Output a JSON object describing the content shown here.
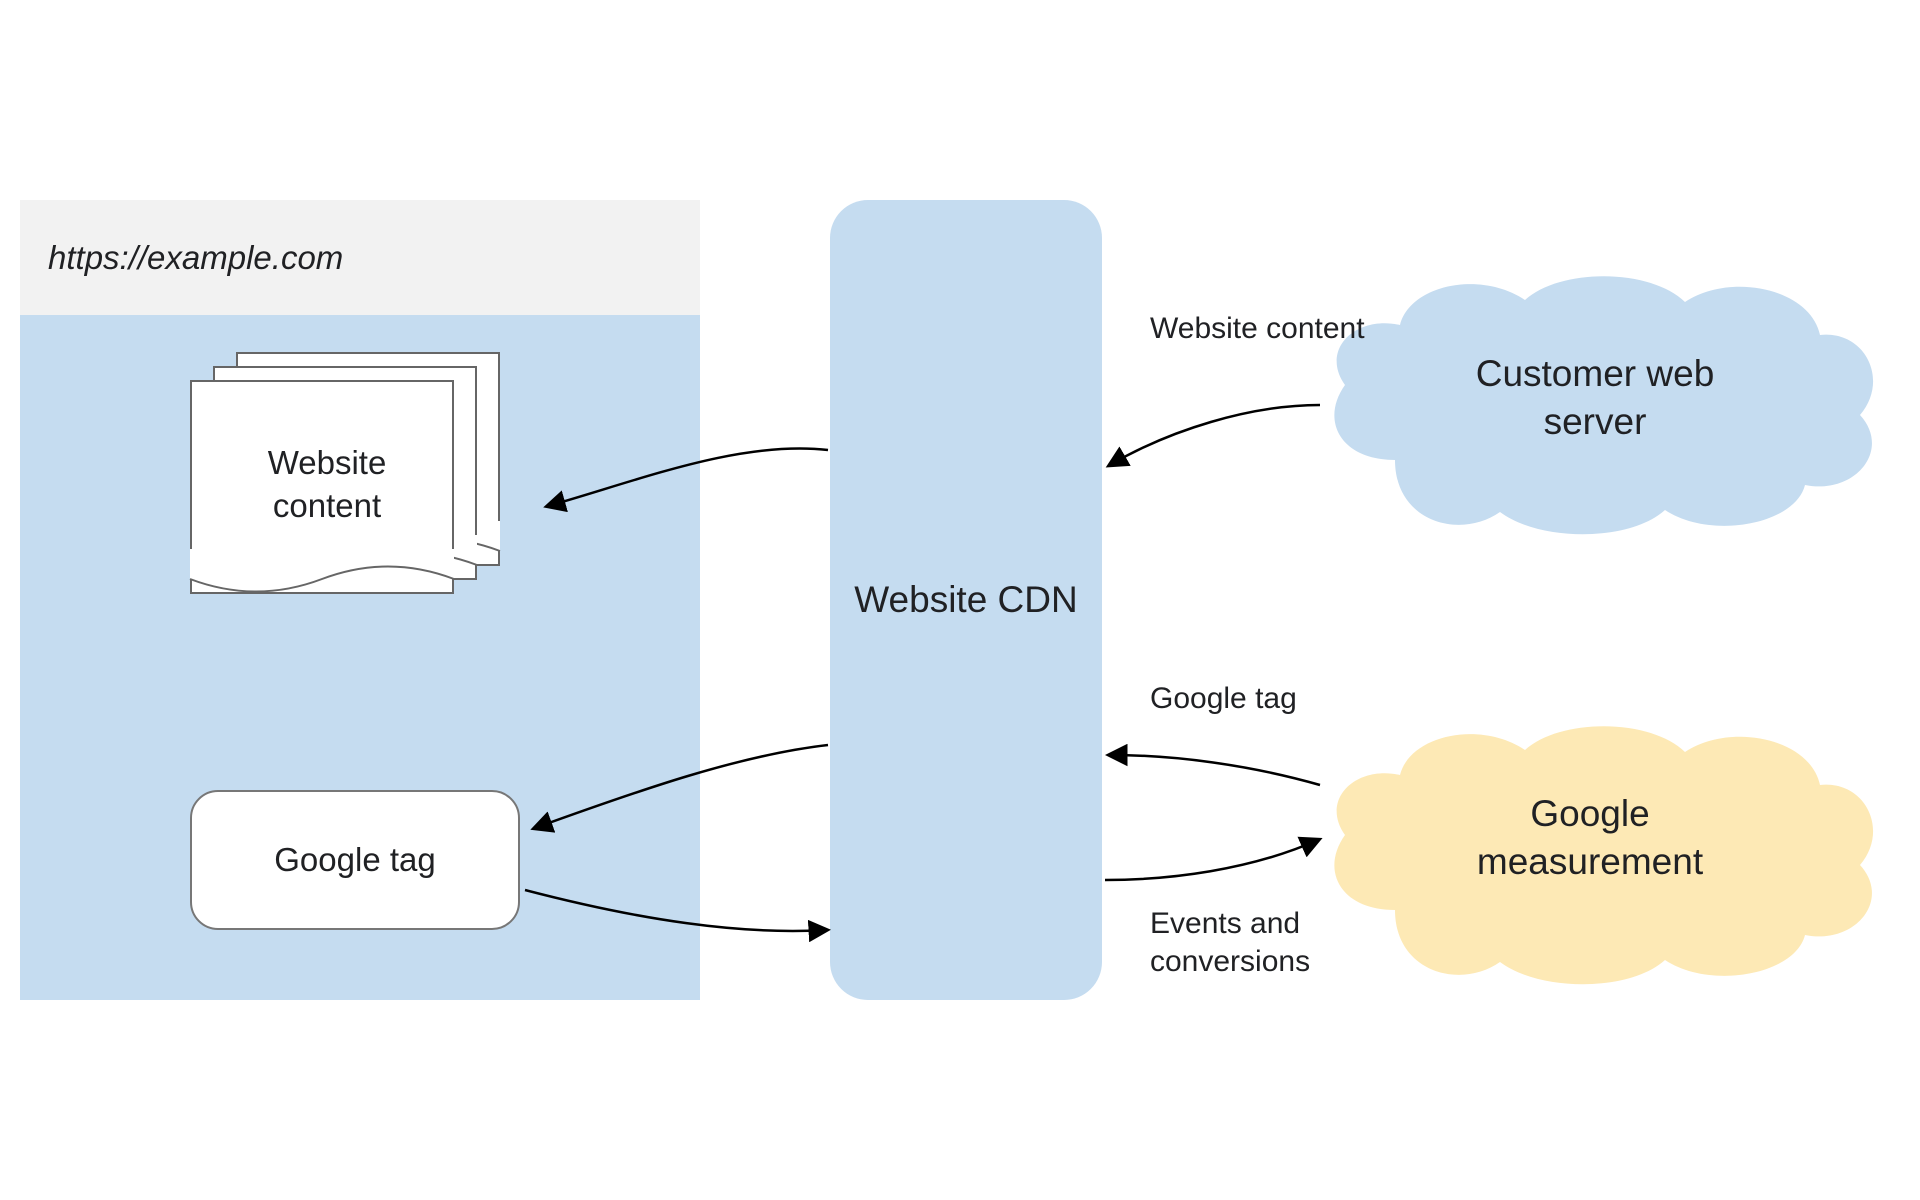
{
  "browser": {
    "url": "https://example.com",
    "content_label": "Website content",
    "tag_label": "Google tag"
  },
  "cdn": {
    "label": "Website CDN"
  },
  "clouds": {
    "customer": "Customer web server",
    "google": "Google measurement"
  },
  "edges": {
    "website_content": "Website content",
    "google_tag": "Google tag",
    "events": "Events and conversions"
  },
  "colors": {
    "blue_fill": "#c5dcf0",
    "yellow_fill": "#fde9b5",
    "grey_fill": "#f2f2f2",
    "stroke": "#000000"
  }
}
